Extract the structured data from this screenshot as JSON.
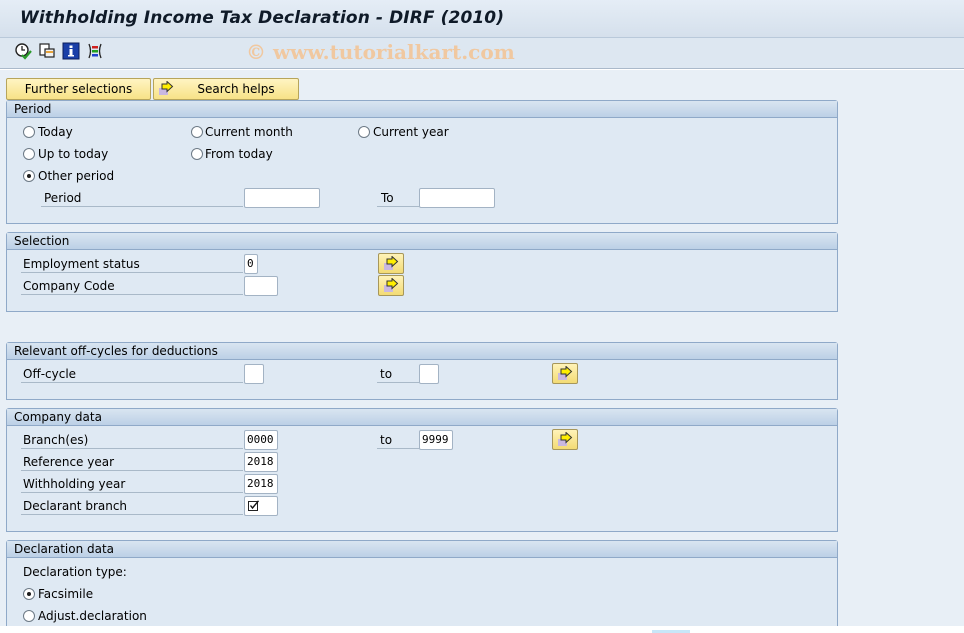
{
  "window": {
    "title": "Withholding Income Tax Declaration - DIRF (2010)"
  },
  "toolbar": {
    "icons": [
      "execute-clock-check-icon",
      "get-variant-icon",
      "program-documentation-icon",
      "selection-options-icon"
    ],
    "watermark": "© www.tutorialkart.com"
  },
  "buttons": {
    "further_selections": "Further selections",
    "search_helps": "Search helps"
  },
  "period": {
    "title": "Period",
    "radios": [
      {
        "label": "Today",
        "selected": false
      },
      {
        "label": "Current month",
        "selected": false
      },
      {
        "label": "Current year",
        "selected": false
      },
      {
        "label": "Up to today",
        "selected": false
      },
      {
        "label": "From today",
        "selected": false
      },
      {
        "label": "Other period",
        "selected": true
      }
    ],
    "period_label": "Period",
    "period_from": "",
    "to_label": "To",
    "period_to": ""
  },
  "selection": {
    "title": "Selection",
    "employment_status_label": "Employment status",
    "employment_status_value": "0",
    "company_code_label": "Company Code",
    "company_code_value": ""
  },
  "offcycles": {
    "title": "Relevant off-cycles for deductions",
    "offcycle_label": "Off-cycle",
    "offcycle_from": "",
    "to_label": "to",
    "offcycle_to": ""
  },
  "company_data": {
    "title": "Company data",
    "branches_label": "Branch(es)",
    "branches_from": "0000",
    "to_label": "to",
    "branches_to": "9999",
    "reference_year_label": "Reference year",
    "reference_year_value": "2018",
    "withholding_year_label": "Withholding year",
    "withholding_year_value": "2018",
    "declarant_branch_label": "Declarant branch",
    "declarant_branch_checked": true
  },
  "declaration_data": {
    "title": "Declaration data",
    "type_label": "Declaration type:",
    "radios": [
      {
        "label": "Facsimile",
        "selected": true
      },
      {
        "label": "Adjust.declaration",
        "selected": false
      }
    ]
  }
}
